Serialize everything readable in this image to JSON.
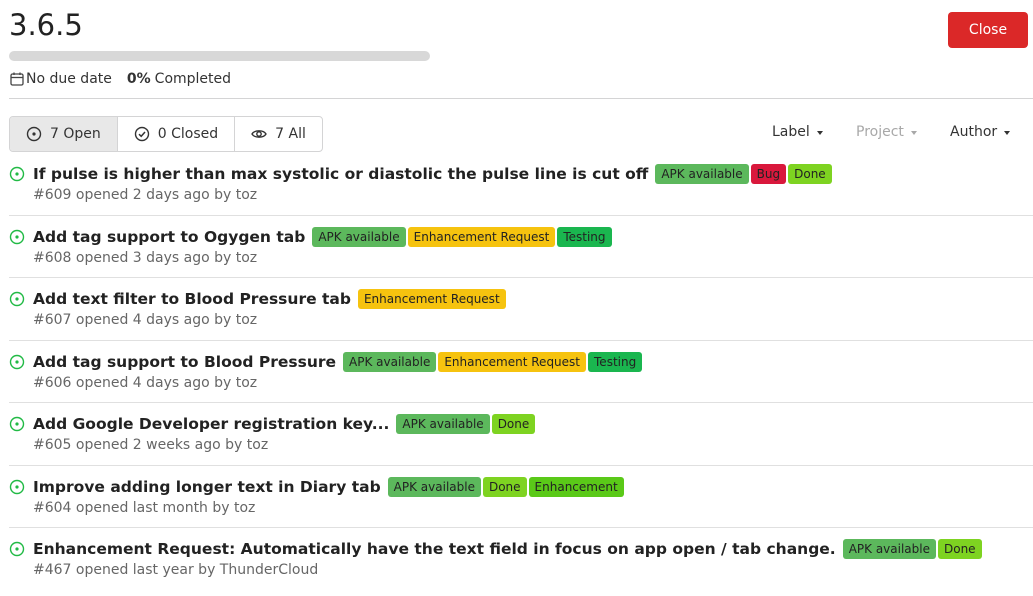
{
  "milestone": {
    "title": "3.6.5",
    "progress_percent": 0,
    "due": "No due date",
    "completed_pct": "0%",
    "completed_label": "Completed",
    "close_label": "Close"
  },
  "tabs": [
    {
      "label": "7 Open",
      "icon": "issue-open-icon",
      "active": true
    },
    {
      "label": "0 Closed",
      "icon": "check-circle-icon",
      "active": false
    },
    {
      "label": "7 All",
      "icon": "eye-icon",
      "active": false
    }
  ],
  "filters": {
    "label": "Label",
    "project": "Project",
    "author": "Author"
  },
  "label_colors": {
    "APK available": "#5cb85c",
    "Bug": "#d9183c",
    "Done": "#7ed321",
    "Enhancement Request": "#f6c30f",
    "Testing": "#1ab64f",
    "Enhancement": "#5ac918"
  },
  "issues": [
    {
      "title": "If pulse is higher than max systolic or diastolic the pulse line is cut off",
      "meta": "#609 opened 2 days ago by toz",
      "labels": [
        "APK available",
        "Bug",
        "Done"
      ]
    },
    {
      "title": "Add tag support to Ogygen tab",
      "meta": "#608 opened 3 days ago by toz",
      "labels": [
        "APK available",
        "Enhancement Request",
        "Testing"
      ]
    },
    {
      "title": "Add text filter to Blood Pressure tab",
      "meta": "#607 opened 4 days ago by toz",
      "labels": [
        "Enhancement Request"
      ]
    },
    {
      "title": "Add tag support to Blood Pressure",
      "meta": "#606 opened 4 days ago by toz",
      "labels": [
        "APK available",
        "Enhancement Request",
        "Testing"
      ]
    },
    {
      "title": "Add Google Developer registration key...",
      "meta": "#605 opened 2 weeks ago by toz",
      "labels": [
        "APK available",
        "Done"
      ]
    },
    {
      "title": "Improve adding longer text in Diary tab",
      "meta": "#604 opened last month by toz",
      "labels": [
        "APK available",
        "Done",
        "Enhancement"
      ]
    },
    {
      "title": "Enhancement Request: Automatically have the text field in focus on app open / tab change.",
      "meta": "#467 opened last year by ThunderCloud",
      "labels": [
        "APK available",
        "Done"
      ]
    }
  ]
}
